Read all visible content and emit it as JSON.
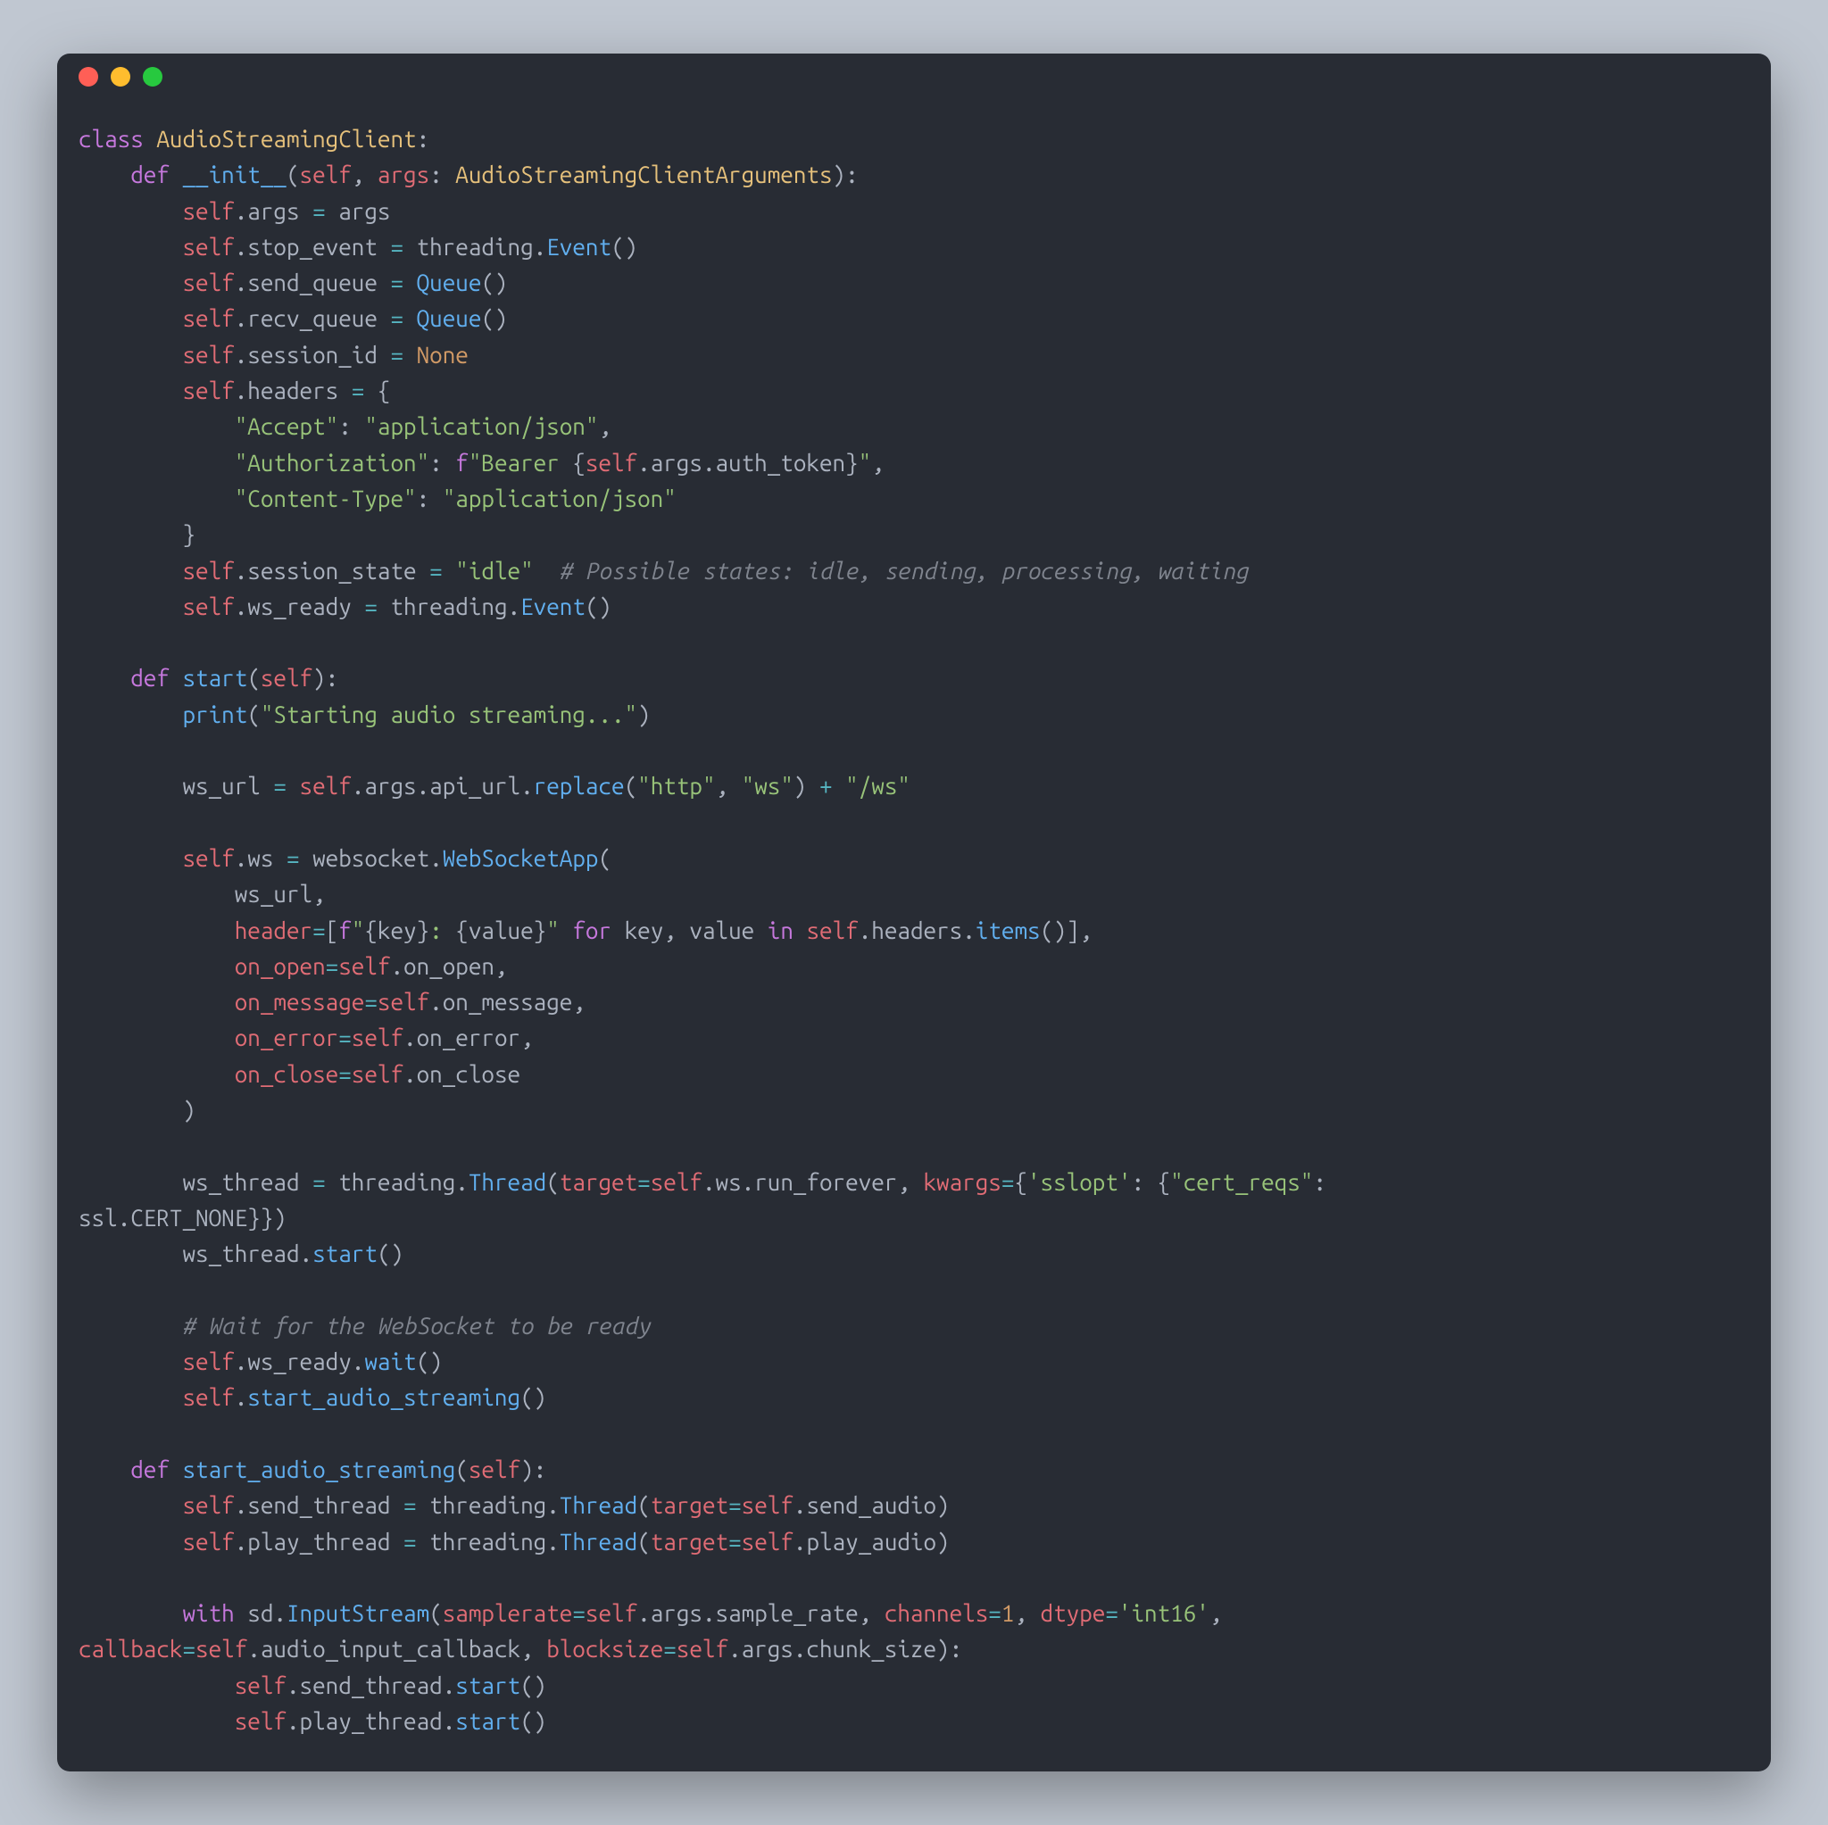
{
  "window": {
    "traffic_lights": [
      "close",
      "minimize",
      "zoom"
    ]
  },
  "tokens": [
    {
      "c": "kw",
      "t": "class"
    },
    {
      "c": "pun",
      "t": " "
    },
    {
      "c": "cls",
      "t": "AudioStreamingClient"
    },
    {
      "c": "pun",
      "t": ":"
    },
    {
      "nl": 1
    },
    {
      "c": "pun",
      "t": "    "
    },
    {
      "c": "kw",
      "t": "def"
    },
    {
      "c": "pun",
      "t": " "
    },
    {
      "c": "fn",
      "t": "__init__"
    },
    {
      "c": "pun",
      "t": "("
    },
    {
      "c": "slf",
      "t": "self"
    },
    {
      "c": "pun",
      "t": ", "
    },
    {
      "c": "prm",
      "t": "args"
    },
    {
      "c": "pun",
      "t": ": "
    },
    {
      "c": "cls",
      "t": "AudioStreamingClientArguments"
    },
    {
      "c": "pun",
      "t": "):"
    },
    {
      "nl": 1
    },
    {
      "c": "pun",
      "t": "        "
    },
    {
      "c": "slf",
      "t": "self"
    },
    {
      "c": "pun",
      "t": "."
    },
    {
      "c": "id",
      "t": "args"
    },
    {
      "c": "pun",
      "t": " "
    },
    {
      "c": "op",
      "t": "="
    },
    {
      "c": "pun",
      "t": " "
    },
    {
      "c": "id",
      "t": "args"
    },
    {
      "nl": 1
    },
    {
      "c": "pun",
      "t": "        "
    },
    {
      "c": "slf",
      "t": "self"
    },
    {
      "c": "pun",
      "t": "."
    },
    {
      "c": "id",
      "t": "stop_event"
    },
    {
      "c": "pun",
      "t": " "
    },
    {
      "c": "op",
      "t": "="
    },
    {
      "c": "pun",
      "t": " "
    },
    {
      "c": "id",
      "t": "threading"
    },
    {
      "c": "pun",
      "t": "."
    },
    {
      "c": "fn",
      "t": "Event"
    },
    {
      "c": "pun",
      "t": "()"
    },
    {
      "nl": 1
    },
    {
      "c": "pun",
      "t": "        "
    },
    {
      "c": "slf",
      "t": "self"
    },
    {
      "c": "pun",
      "t": "."
    },
    {
      "c": "id",
      "t": "send_queue"
    },
    {
      "c": "pun",
      "t": " "
    },
    {
      "c": "op",
      "t": "="
    },
    {
      "c": "pun",
      "t": " "
    },
    {
      "c": "fn",
      "t": "Queue"
    },
    {
      "c": "pun",
      "t": "()"
    },
    {
      "nl": 1
    },
    {
      "c": "pun",
      "t": "        "
    },
    {
      "c": "slf",
      "t": "self"
    },
    {
      "c": "pun",
      "t": "."
    },
    {
      "c": "id",
      "t": "recv_queue"
    },
    {
      "c": "pun",
      "t": " "
    },
    {
      "c": "op",
      "t": "="
    },
    {
      "c": "pun",
      "t": " "
    },
    {
      "c": "fn",
      "t": "Queue"
    },
    {
      "c": "pun",
      "t": "()"
    },
    {
      "nl": 1
    },
    {
      "c": "pun",
      "t": "        "
    },
    {
      "c": "slf",
      "t": "self"
    },
    {
      "c": "pun",
      "t": "."
    },
    {
      "c": "id",
      "t": "session_id"
    },
    {
      "c": "pun",
      "t": " "
    },
    {
      "c": "op",
      "t": "="
    },
    {
      "c": "pun",
      "t": " "
    },
    {
      "c": "cns",
      "t": "None"
    },
    {
      "nl": 1
    },
    {
      "c": "pun",
      "t": "        "
    },
    {
      "c": "slf",
      "t": "self"
    },
    {
      "c": "pun",
      "t": "."
    },
    {
      "c": "id",
      "t": "headers"
    },
    {
      "c": "pun",
      "t": " "
    },
    {
      "c": "op",
      "t": "="
    },
    {
      "c": "pun",
      "t": " {"
    },
    {
      "nl": 1
    },
    {
      "c": "pun",
      "t": "            "
    },
    {
      "c": "str",
      "t": "\"Accept\""
    },
    {
      "c": "pun",
      "t": ": "
    },
    {
      "c": "str",
      "t": "\"application/json\""
    },
    {
      "c": "pun",
      "t": ","
    },
    {
      "nl": 1
    },
    {
      "c": "pun",
      "t": "            "
    },
    {
      "c": "str",
      "t": "\"Authorization\""
    },
    {
      "c": "pun",
      "t": ": "
    },
    {
      "c": "kw",
      "t": "f"
    },
    {
      "c": "str",
      "t": "\"Bearer "
    },
    {
      "c": "pun",
      "t": "{"
    },
    {
      "c": "slf",
      "t": "self"
    },
    {
      "c": "pun",
      "t": "."
    },
    {
      "c": "id",
      "t": "args"
    },
    {
      "c": "pun",
      "t": "."
    },
    {
      "c": "id",
      "t": "auth_token"
    },
    {
      "c": "pun",
      "t": "}"
    },
    {
      "c": "str",
      "t": "\""
    },
    {
      "c": "pun",
      "t": ","
    },
    {
      "nl": 1
    },
    {
      "c": "pun",
      "t": "            "
    },
    {
      "c": "str",
      "t": "\"Content-Type\""
    },
    {
      "c": "pun",
      "t": ": "
    },
    {
      "c": "str",
      "t": "\"application/json\""
    },
    {
      "nl": 1
    },
    {
      "c": "pun",
      "t": "        }"
    },
    {
      "nl": 1
    },
    {
      "c": "pun",
      "t": "        "
    },
    {
      "c": "slf",
      "t": "self"
    },
    {
      "c": "pun",
      "t": "."
    },
    {
      "c": "id",
      "t": "session_state"
    },
    {
      "c": "pun",
      "t": " "
    },
    {
      "c": "op",
      "t": "="
    },
    {
      "c": "pun",
      "t": " "
    },
    {
      "c": "str",
      "t": "\"idle\""
    },
    {
      "c": "pun",
      "t": "  "
    },
    {
      "c": "cmt",
      "t": "# Possible states: idle, sending, processing, waiting"
    },
    {
      "nl": 1
    },
    {
      "c": "pun",
      "t": "        "
    },
    {
      "c": "slf",
      "t": "self"
    },
    {
      "c": "pun",
      "t": "."
    },
    {
      "c": "id",
      "t": "ws_ready"
    },
    {
      "c": "pun",
      "t": " "
    },
    {
      "c": "op",
      "t": "="
    },
    {
      "c": "pun",
      "t": " "
    },
    {
      "c": "id",
      "t": "threading"
    },
    {
      "c": "pun",
      "t": "."
    },
    {
      "c": "fn",
      "t": "Event"
    },
    {
      "c": "pun",
      "t": "()"
    },
    {
      "nl": 1
    },
    {
      "nl": 1
    },
    {
      "c": "pun",
      "t": "    "
    },
    {
      "c": "kw",
      "t": "def"
    },
    {
      "c": "pun",
      "t": " "
    },
    {
      "c": "fn",
      "t": "start"
    },
    {
      "c": "pun",
      "t": "("
    },
    {
      "c": "slf",
      "t": "self"
    },
    {
      "c": "pun",
      "t": "):"
    },
    {
      "nl": 1
    },
    {
      "c": "pun",
      "t": "        "
    },
    {
      "c": "fn",
      "t": "print"
    },
    {
      "c": "pun",
      "t": "("
    },
    {
      "c": "str",
      "t": "\"Starting audio streaming...\""
    },
    {
      "c": "pun",
      "t": ")"
    },
    {
      "nl": 1
    },
    {
      "nl": 1
    },
    {
      "c": "pun",
      "t": "        "
    },
    {
      "c": "id",
      "t": "ws_url"
    },
    {
      "c": "pun",
      "t": " "
    },
    {
      "c": "op",
      "t": "="
    },
    {
      "c": "pun",
      "t": " "
    },
    {
      "c": "slf",
      "t": "self"
    },
    {
      "c": "pun",
      "t": "."
    },
    {
      "c": "id",
      "t": "args"
    },
    {
      "c": "pun",
      "t": "."
    },
    {
      "c": "id",
      "t": "api_url"
    },
    {
      "c": "pun",
      "t": "."
    },
    {
      "c": "fn",
      "t": "replace"
    },
    {
      "c": "pun",
      "t": "("
    },
    {
      "c": "str",
      "t": "\"http\""
    },
    {
      "c": "pun",
      "t": ", "
    },
    {
      "c": "str",
      "t": "\"ws\""
    },
    {
      "c": "pun",
      "t": ") "
    },
    {
      "c": "op",
      "t": "+"
    },
    {
      "c": "pun",
      "t": " "
    },
    {
      "c": "str",
      "t": "\"/ws\""
    },
    {
      "nl": 1
    },
    {
      "nl": 1
    },
    {
      "c": "pun",
      "t": "        "
    },
    {
      "c": "slf",
      "t": "self"
    },
    {
      "c": "pun",
      "t": "."
    },
    {
      "c": "id",
      "t": "ws"
    },
    {
      "c": "pun",
      "t": " "
    },
    {
      "c": "op",
      "t": "="
    },
    {
      "c": "pun",
      "t": " "
    },
    {
      "c": "id",
      "t": "websocket"
    },
    {
      "c": "pun",
      "t": "."
    },
    {
      "c": "fn",
      "t": "WebSocketApp"
    },
    {
      "c": "pun",
      "t": "("
    },
    {
      "nl": 1
    },
    {
      "c": "pun",
      "t": "            "
    },
    {
      "c": "id",
      "t": "ws_url"
    },
    {
      "c": "pun",
      "t": ","
    },
    {
      "nl": 1
    },
    {
      "c": "pun",
      "t": "            "
    },
    {
      "c": "prm",
      "t": "header"
    },
    {
      "c": "op",
      "t": "="
    },
    {
      "c": "pun",
      "t": "["
    },
    {
      "c": "kw",
      "t": "f"
    },
    {
      "c": "str",
      "t": "\""
    },
    {
      "c": "pun",
      "t": "{"
    },
    {
      "c": "id",
      "t": "key"
    },
    {
      "c": "pun",
      "t": "}"
    },
    {
      "c": "str",
      "t": ": "
    },
    {
      "c": "pun",
      "t": "{"
    },
    {
      "c": "id",
      "t": "value"
    },
    {
      "c": "pun",
      "t": "}"
    },
    {
      "c": "str",
      "t": "\""
    },
    {
      "c": "pun",
      "t": " "
    },
    {
      "c": "kw",
      "t": "for"
    },
    {
      "c": "pun",
      "t": " "
    },
    {
      "c": "id",
      "t": "key"
    },
    {
      "c": "pun",
      "t": ", "
    },
    {
      "c": "id",
      "t": "value"
    },
    {
      "c": "pun",
      "t": " "
    },
    {
      "c": "kw",
      "t": "in"
    },
    {
      "c": "pun",
      "t": " "
    },
    {
      "c": "slf",
      "t": "self"
    },
    {
      "c": "pun",
      "t": "."
    },
    {
      "c": "id",
      "t": "headers"
    },
    {
      "c": "pun",
      "t": "."
    },
    {
      "c": "fn",
      "t": "items"
    },
    {
      "c": "pun",
      "t": "()],"
    },
    {
      "nl": 1
    },
    {
      "c": "pun",
      "t": "            "
    },
    {
      "c": "prm",
      "t": "on_open"
    },
    {
      "c": "op",
      "t": "="
    },
    {
      "c": "slf",
      "t": "self"
    },
    {
      "c": "pun",
      "t": "."
    },
    {
      "c": "id",
      "t": "on_open"
    },
    {
      "c": "pun",
      "t": ","
    },
    {
      "nl": 1
    },
    {
      "c": "pun",
      "t": "            "
    },
    {
      "c": "prm",
      "t": "on_message"
    },
    {
      "c": "op",
      "t": "="
    },
    {
      "c": "slf",
      "t": "self"
    },
    {
      "c": "pun",
      "t": "."
    },
    {
      "c": "id",
      "t": "on_message"
    },
    {
      "c": "pun",
      "t": ","
    },
    {
      "nl": 1
    },
    {
      "c": "pun",
      "t": "            "
    },
    {
      "c": "prm",
      "t": "on_error"
    },
    {
      "c": "op",
      "t": "="
    },
    {
      "c": "slf",
      "t": "self"
    },
    {
      "c": "pun",
      "t": "."
    },
    {
      "c": "id",
      "t": "on_error"
    },
    {
      "c": "pun",
      "t": ","
    },
    {
      "nl": 1
    },
    {
      "c": "pun",
      "t": "            "
    },
    {
      "c": "prm",
      "t": "on_close"
    },
    {
      "c": "op",
      "t": "="
    },
    {
      "c": "slf",
      "t": "self"
    },
    {
      "c": "pun",
      "t": "."
    },
    {
      "c": "id",
      "t": "on_close"
    },
    {
      "nl": 1
    },
    {
      "c": "pun",
      "t": "        )"
    },
    {
      "nl": 1
    },
    {
      "nl": 1
    },
    {
      "c": "pun",
      "t": "        "
    },
    {
      "c": "id",
      "t": "ws_thread"
    },
    {
      "c": "pun",
      "t": " "
    },
    {
      "c": "op",
      "t": "="
    },
    {
      "c": "pun",
      "t": " "
    },
    {
      "c": "id",
      "t": "threading"
    },
    {
      "c": "pun",
      "t": "."
    },
    {
      "c": "fn",
      "t": "Thread"
    },
    {
      "c": "pun",
      "t": "("
    },
    {
      "c": "prm",
      "t": "target"
    },
    {
      "c": "op",
      "t": "="
    },
    {
      "c": "slf",
      "t": "self"
    },
    {
      "c": "pun",
      "t": "."
    },
    {
      "c": "id",
      "t": "ws"
    },
    {
      "c": "pun",
      "t": "."
    },
    {
      "c": "id",
      "t": "run_forever"
    },
    {
      "c": "pun",
      "t": ", "
    },
    {
      "c": "prm",
      "t": "kwargs"
    },
    {
      "c": "op",
      "t": "="
    },
    {
      "c": "pun",
      "t": "{"
    },
    {
      "c": "str",
      "t": "'sslopt'"
    },
    {
      "c": "pun",
      "t": ": {"
    },
    {
      "c": "str",
      "t": "\"cert_reqs\""
    },
    {
      "c": "pun",
      "t": ": "
    },
    {
      "nl": 1
    },
    {
      "c": "id",
      "t": "ssl"
    },
    {
      "c": "pun",
      "t": "."
    },
    {
      "c": "id",
      "t": "CERT_NONE"
    },
    {
      "c": "pun",
      "t": "}})"
    },
    {
      "nl": 1
    },
    {
      "c": "pun",
      "t": "        "
    },
    {
      "c": "id",
      "t": "ws_thread"
    },
    {
      "c": "pun",
      "t": "."
    },
    {
      "c": "fn",
      "t": "start"
    },
    {
      "c": "pun",
      "t": "()"
    },
    {
      "nl": 1
    },
    {
      "nl": 1
    },
    {
      "c": "pun",
      "t": "        "
    },
    {
      "c": "cmt",
      "t": "# Wait for the WebSocket to be ready"
    },
    {
      "nl": 1
    },
    {
      "c": "pun",
      "t": "        "
    },
    {
      "c": "slf",
      "t": "self"
    },
    {
      "c": "pun",
      "t": "."
    },
    {
      "c": "id",
      "t": "ws_ready"
    },
    {
      "c": "pun",
      "t": "."
    },
    {
      "c": "fn",
      "t": "wait"
    },
    {
      "c": "pun",
      "t": "()"
    },
    {
      "nl": 1
    },
    {
      "c": "pun",
      "t": "        "
    },
    {
      "c": "slf",
      "t": "self"
    },
    {
      "c": "pun",
      "t": "."
    },
    {
      "c": "fn",
      "t": "start_audio_streaming"
    },
    {
      "c": "pun",
      "t": "()"
    },
    {
      "nl": 1
    },
    {
      "nl": 1
    },
    {
      "c": "pun",
      "t": "    "
    },
    {
      "c": "kw",
      "t": "def"
    },
    {
      "c": "pun",
      "t": " "
    },
    {
      "c": "fn",
      "t": "start_audio_streaming"
    },
    {
      "c": "pun",
      "t": "("
    },
    {
      "c": "slf",
      "t": "self"
    },
    {
      "c": "pun",
      "t": "):"
    },
    {
      "nl": 1
    },
    {
      "c": "pun",
      "t": "        "
    },
    {
      "c": "slf",
      "t": "self"
    },
    {
      "c": "pun",
      "t": "."
    },
    {
      "c": "id",
      "t": "send_thread"
    },
    {
      "c": "pun",
      "t": " "
    },
    {
      "c": "op",
      "t": "="
    },
    {
      "c": "pun",
      "t": " "
    },
    {
      "c": "id",
      "t": "threading"
    },
    {
      "c": "pun",
      "t": "."
    },
    {
      "c": "fn",
      "t": "Thread"
    },
    {
      "c": "pun",
      "t": "("
    },
    {
      "c": "prm",
      "t": "target"
    },
    {
      "c": "op",
      "t": "="
    },
    {
      "c": "slf",
      "t": "self"
    },
    {
      "c": "pun",
      "t": "."
    },
    {
      "c": "id",
      "t": "send_audio"
    },
    {
      "c": "pun",
      "t": ")"
    },
    {
      "nl": 1
    },
    {
      "c": "pun",
      "t": "        "
    },
    {
      "c": "slf",
      "t": "self"
    },
    {
      "c": "pun",
      "t": "."
    },
    {
      "c": "id",
      "t": "play_thread"
    },
    {
      "c": "pun",
      "t": " "
    },
    {
      "c": "op",
      "t": "="
    },
    {
      "c": "pun",
      "t": " "
    },
    {
      "c": "id",
      "t": "threading"
    },
    {
      "c": "pun",
      "t": "."
    },
    {
      "c": "fn",
      "t": "Thread"
    },
    {
      "c": "pun",
      "t": "("
    },
    {
      "c": "prm",
      "t": "target"
    },
    {
      "c": "op",
      "t": "="
    },
    {
      "c": "slf",
      "t": "self"
    },
    {
      "c": "pun",
      "t": "."
    },
    {
      "c": "id",
      "t": "play_audio"
    },
    {
      "c": "pun",
      "t": ")"
    },
    {
      "nl": 1
    },
    {
      "nl": 1
    },
    {
      "c": "pun",
      "t": "        "
    },
    {
      "c": "kw",
      "t": "with"
    },
    {
      "c": "pun",
      "t": " "
    },
    {
      "c": "id",
      "t": "sd"
    },
    {
      "c": "pun",
      "t": "."
    },
    {
      "c": "fn",
      "t": "InputStream"
    },
    {
      "c": "pun",
      "t": "("
    },
    {
      "c": "prm",
      "t": "samplerate"
    },
    {
      "c": "op",
      "t": "="
    },
    {
      "c": "slf",
      "t": "self"
    },
    {
      "c": "pun",
      "t": "."
    },
    {
      "c": "id",
      "t": "args"
    },
    {
      "c": "pun",
      "t": "."
    },
    {
      "c": "id",
      "t": "sample_rate"
    },
    {
      "c": "pun",
      "t": ", "
    },
    {
      "c": "prm",
      "t": "channels"
    },
    {
      "c": "op",
      "t": "="
    },
    {
      "c": "num",
      "t": "1"
    },
    {
      "c": "pun",
      "t": ", "
    },
    {
      "c": "prm",
      "t": "dtype"
    },
    {
      "c": "op",
      "t": "="
    },
    {
      "c": "str",
      "t": "'int16'"
    },
    {
      "c": "pun",
      "t": ", "
    },
    {
      "nl": 1
    },
    {
      "c": "prm",
      "t": "callback"
    },
    {
      "c": "op",
      "t": "="
    },
    {
      "c": "slf",
      "t": "self"
    },
    {
      "c": "pun",
      "t": "."
    },
    {
      "c": "id",
      "t": "audio_input_callback"
    },
    {
      "c": "pun",
      "t": ", "
    },
    {
      "c": "prm",
      "t": "blocksize"
    },
    {
      "c": "op",
      "t": "="
    },
    {
      "c": "slf",
      "t": "self"
    },
    {
      "c": "pun",
      "t": "."
    },
    {
      "c": "id",
      "t": "args"
    },
    {
      "c": "pun",
      "t": "."
    },
    {
      "c": "id",
      "t": "chunk_size"
    },
    {
      "c": "pun",
      "t": "):"
    },
    {
      "nl": 1
    },
    {
      "c": "pun",
      "t": "            "
    },
    {
      "c": "slf",
      "t": "self"
    },
    {
      "c": "pun",
      "t": "."
    },
    {
      "c": "id",
      "t": "send_thread"
    },
    {
      "c": "pun",
      "t": "."
    },
    {
      "c": "fn",
      "t": "start"
    },
    {
      "c": "pun",
      "t": "()"
    },
    {
      "nl": 1
    },
    {
      "c": "pun",
      "t": "            "
    },
    {
      "c": "slf",
      "t": "self"
    },
    {
      "c": "pun",
      "t": "."
    },
    {
      "c": "id",
      "t": "play_thread"
    },
    {
      "c": "pun",
      "t": "."
    },
    {
      "c": "fn",
      "t": "start"
    },
    {
      "c": "pun",
      "t": "()"
    }
  ]
}
